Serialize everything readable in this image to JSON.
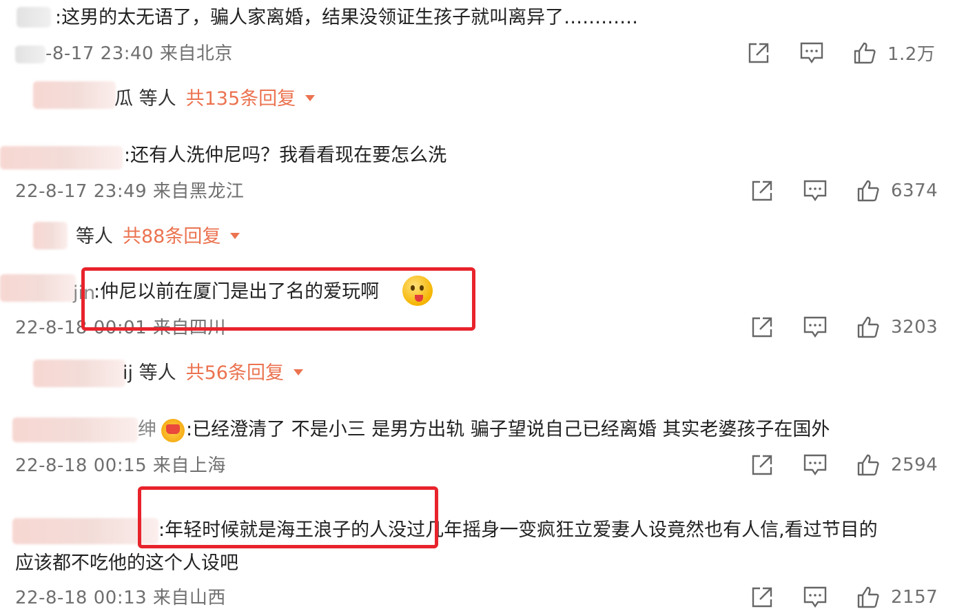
{
  "comments": [
    {
      "text": ":这男的太无语了，骗人家离婚，结果没领证生孩子就叫离异了…………",
      "meta": "-8-17 23:40 来自北京",
      "likes": "1.2万",
      "reply_who": "瓜 等人",
      "reply_count": "共135条回复"
    },
    {
      "text": ":还有人洗仲尼吗？我看看现在要怎么洗",
      "meta": "22-8-17 23:49 来自黑龙江",
      "likes": "6374",
      "reply_who": "等人",
      "reply_count": "共88条回复"
    },
    {
      "name_fragment": "jin",
      "text": ":仲尼以前在厦门是出了名的爱玩啊",
      "meta": "22-8-18 00:01 来自四川",
      "likes": "3203",
      "reply_who": "ij 等人",
      "reply_count": "共56条回复"
    },
    {
      "name_fragment": "绅",
      "text": ":已经澄清了 不是小三 是男方出轨 骗子望说自己已经离婚 其实老婆孩子在国外",
      "meta": "22-8-18 00:15 来自上海",
      "likes": "2594"
    },
    {
      "text_line1": ":年轻时候就是海王浪子的人没过几年摇身一变疯狂立爱妻人设竟然也有人信,看过节目的",
      "text_line2": "应该都不吃他的这个人设吧",
      "meta": "22-8-18 00:13 来自山西",
      "likes": "2157"
    }
  ],
  "colors": {
    "accent": "#eb7350",
    "highlight_box": "#e8232b",
    "meta_gray": "#6f6f6f"
  },
  "icons": [
    "share-icon",
    "comment-icon",
    "like-icon"
  ]
}
